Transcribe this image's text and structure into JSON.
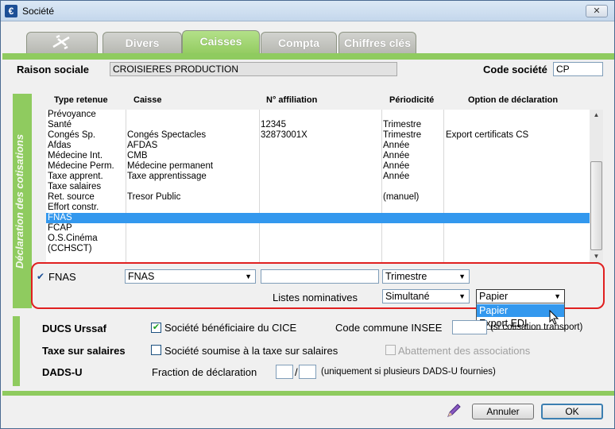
{
  "window": {
    "title": "Société",
    "close": "✕"
  },
  "tabs": [
    "",
    "Divers",
    "Caisses",
    "Compta",
    "Chiffres clés"
  ],
  "header": {
    "raison_sociale_label": "Raison sociale",
    "raison_sociale_value": "CROISIERES PRODUCTION",
    "code_societe_label": "Code société",
    "code_societe_value": "CP"
  },
  "side_label": "Déclaration des cotisations",
  "grid": {
    "columns": [
      "Type retenue",
      "Caisse",
      "N° affiliation",
      "Périodicité",
      "Option de déclaration"
    ],
    "rows": [
      [
        "Prévoyance",
        "",
        "",
        "",
        ""
      ],
      [
        "Santé",
        "",
        "12345",
        "Trimestre",
        ""
      ],
      [
        "Congés Sp.",
        "Congés Spectacles",
        "32873001X",
        "Trimestre",
        "Export certificats CS"
      ],
      [
        "Afdas",
        "AFDAS",
        "",
        "Année",
        ""
      ],
      [
        "Médecine Int.",
        "CMB",
        "",
        "Année",
        ""
      ],
      [
        "Médecine Perm.",
        "Médecine permanent",
        "",
        "Année",
        ""
      ],
      [
        "Taxe apprent.",
        "Taxe apprentissage",
        "",
        "Année",
        ""
      ],
      [
        "Taxe salaires",
        "",
        "",
        "",
        ""
      ],
      [
        "Ret. source",
        "Tresor Public",
        "",
        "(manuel)",
        ""
      ],
      [
        "Effort constr.",
        "",
        "",
        "",
        ""
      ],
      [
        "FNAS",
        "",
        "",
        "",
        ""
      ],
      [
        "FCAP",
        "",
        "",
        "",
        ""
      ],
      [
        "O.S.Cinéma",
        "",
        "",
        "",
        ""
      ],
      [
        "(CCHSCT)",
        "",
        "",
        "",
        ""
      ]
    ],
    "selected_index": 10
  },
  "edit": {
    "check": "✔",
    "type": "FNAS",
    "caisse": "FNAS",
    "affiliation": "",
    "periodicite": "Trimestre",
    "listes_label": "Listes nominatives",
    "listes_value": "Simultané",
    "option_value": "Papier",
    "option_options": [
      "Papier",
      "Export EDI"
    ],
    "option_highlighted": "Papier"
  },
  "ducs": {
    "label": "DUCS Urssaf",
    "cice_label": "Société bénéficiaire du CICE",
    "cice_checked": true,
    "insee_label": "Code commune INSEE",
    "insee_value": "",
    "insee_hint": "(si cotisation transport)"
  },
  "taxe": {
    "label": "Taxe sur salaires",
    "soumise_label": "Société soumise à la taxe sur salaires",
    "abattement_label": "Abattement des associations"
  },
  "dadsu": {
    "label": "DADS-U",
    "fraction_label": "Fraction de déclaration",
    "sep": "/",
    "hint": "(uniquement si plusieurs DADS-U fournies)"
  },
  "buttons": {
    "cancel": "Annuler",
    "ok": "OK"
  }
}
